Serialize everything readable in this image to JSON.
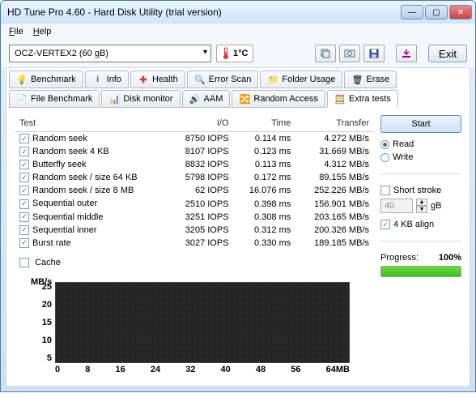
{
  "window": {
    "title": "HD Tune Pro 4.60 - Hard Disk Utility (trial version)"
  },
  "menu": {
    "file": "File",
    "help": "Help"
  },
  "toolbar": {
    "drive": "OCZ-VERTEX2 (60 gB)",
    "temp": "1°C",
    "exit": "Exit"
  },
  "tabs": {
    "row1": [
      {
        "key": "benchmark",
        "label": "Benchmark"
      },
      {
        "key": "info",
        "label": "Info"
      },
      {
        "key": "health",
        "label": "Health"
      },
      {
        "key": "errorscan",
        "label": "Error Scan"
      },
      {
        "key": "folderusage",
        "label": "Folder Usage"
      },
      {
        "key": "erase",
        "label": "Erase"
      }
    ],
    "row2": [
      {
        "key": "filebench",
        "label": "File Benchmark"
      },
      {
        "key": "diskmon",
        "label": "Disk monitor"
      },
      {
        "key": "aam",
        "label": "AAM"
      },
      {
        "key": "random",
        "label": "Random Access"
      },
      {
        "key": "extra",
        "label": "Extra tests",
        "active": true
      }
    ]
  },
  "table": {
    "headers": {
      "test": "Test",
      "io": "I/O",
      "time": "Time",
      "transfer": "Transfer"
    },
    "rows": [
      {
        "name": "Random seek",
        "io": "8750 IOPS",
        "time": "0.114 ms",
        "transfer": "4.272 MB/s"
      },
      {
        "name": "Random seek 4 KB",
        "io": "8107 IOPS",
        "time": "0.123 ms",
        "transfer": "31.669 MB/s"
      },
      {
        "name": "Butterfly seek",
        "io": "8832 IOPS",
        "time": "0.113 ms",
        "transfer": "4.312 MB/s"
      },
      {
        "name": "Random seek / size 64 KB",
        "io": "5798 IOPS",
        "time": "0.172 ms",
        "transfer": "89.155 MB/s"
      },
      {
        "name": "Random seek / size 8 MB",
        "io": "62 IOPS",
        "time": "16.076 ms",
        "transfer": "252.226 MB/s"
      },
      {
        "name": "Sequential outer",
        "io": "2510 IOPS",
        "time": "0.398 ms",
        "transfer": "156.901 MB/s"
      },
      {
        "name": "Sequential middle",
        "io": "3251 IOPS",
        "time": "0.308 ms",
        "transfer": "203.165 MB/s"
      },
      {
        "name": "Sequential inner",
        "io": "3205 IOPS",
        "time": "0.312 ms",
        "transfer": "200.326 MB/s"
      },
      {
        "name": "Burst rate",
        "io": "3027 IOPS",
        "time": "0.330 ms",
        "transfer": "189.185 MB/s"
      }
    ],
    "cache": "Cache"
  },
  "side": {
    "start": "Start",
    "read": "Read",
    "write": "Write",
    "shortstroke": "Short stroke",
    "stroke_value": "40",
    "stroke_unit": "gB",
    "align4kb": "4 KB align",
    "progress_label": "Progress:",
    "progress_value": "100%",
    "progress_pct": 100
  },
  "chart": {
    "ylabel": "MB/s",
    "yticks": [
      "25",
      "20",
      "15",
      "10",
      "5"
    ],
    "xticks": [
      "0",
      "8",
      "16",
      "24",
      "32",
      "40",
      "48",
      "56",
      "64MB"
    ]
  },
  "chart_data": {
    "type": "line",
    "series": [],
    "xlabel": "MB",
    "ylabel": "MB/s",
    "xlim": [
      0,
      64
    ],
    "ylim": [
      0,
      25
    ],
    "note": "chart area rendered empty (black grid, no plotted data visible)"
  }
}
